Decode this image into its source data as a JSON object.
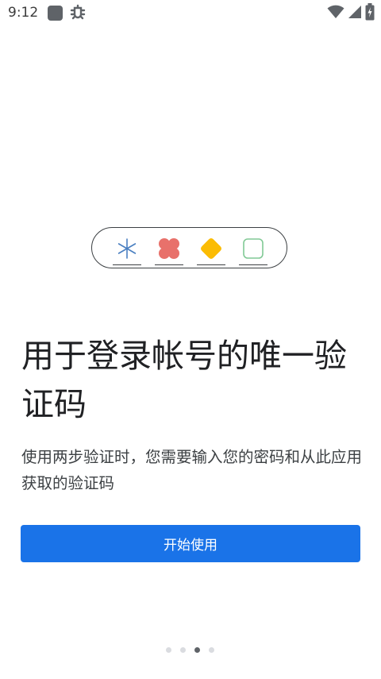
{
  "status_bar": {
    "time": "9:12",
    "icons": [
      "app-icon",
      "bug-icon",
      "wifi-icon",
      "cellular-signal-icon",
      "battery-charging-icon"
    ]
  },
  "illustration": {
    "slots": [
      {
        "icon": "asterisk-icon",
        "color": "#4a7fc1"
      },
      {
        "icon": "clover-icon",
        "color": "#e8716b"
      },
      {
        "icon": "diamond-icon",
        "color": "#fbbc04"
      },
      {
        "icon": "rounded-square-icon",
        "color": "#81c995"
      }
    ]
  },
  "onboarding": {
    "title": "用于登录帐号的唯一验证码",
    "description": "使用两步验证时，您需要输入您的密码和从此应用获取的验证码",
    "button_label": "开始使用"
  },
  "pager": {
    "page_count": 4,
    "current_page": 3
  },
  "colors": {
    "primary": "#1a73e8",
    "text": "#202124",
    "dot_inactive": "#dadce0",
    "dot_active": "#5f6368"
  }
}
